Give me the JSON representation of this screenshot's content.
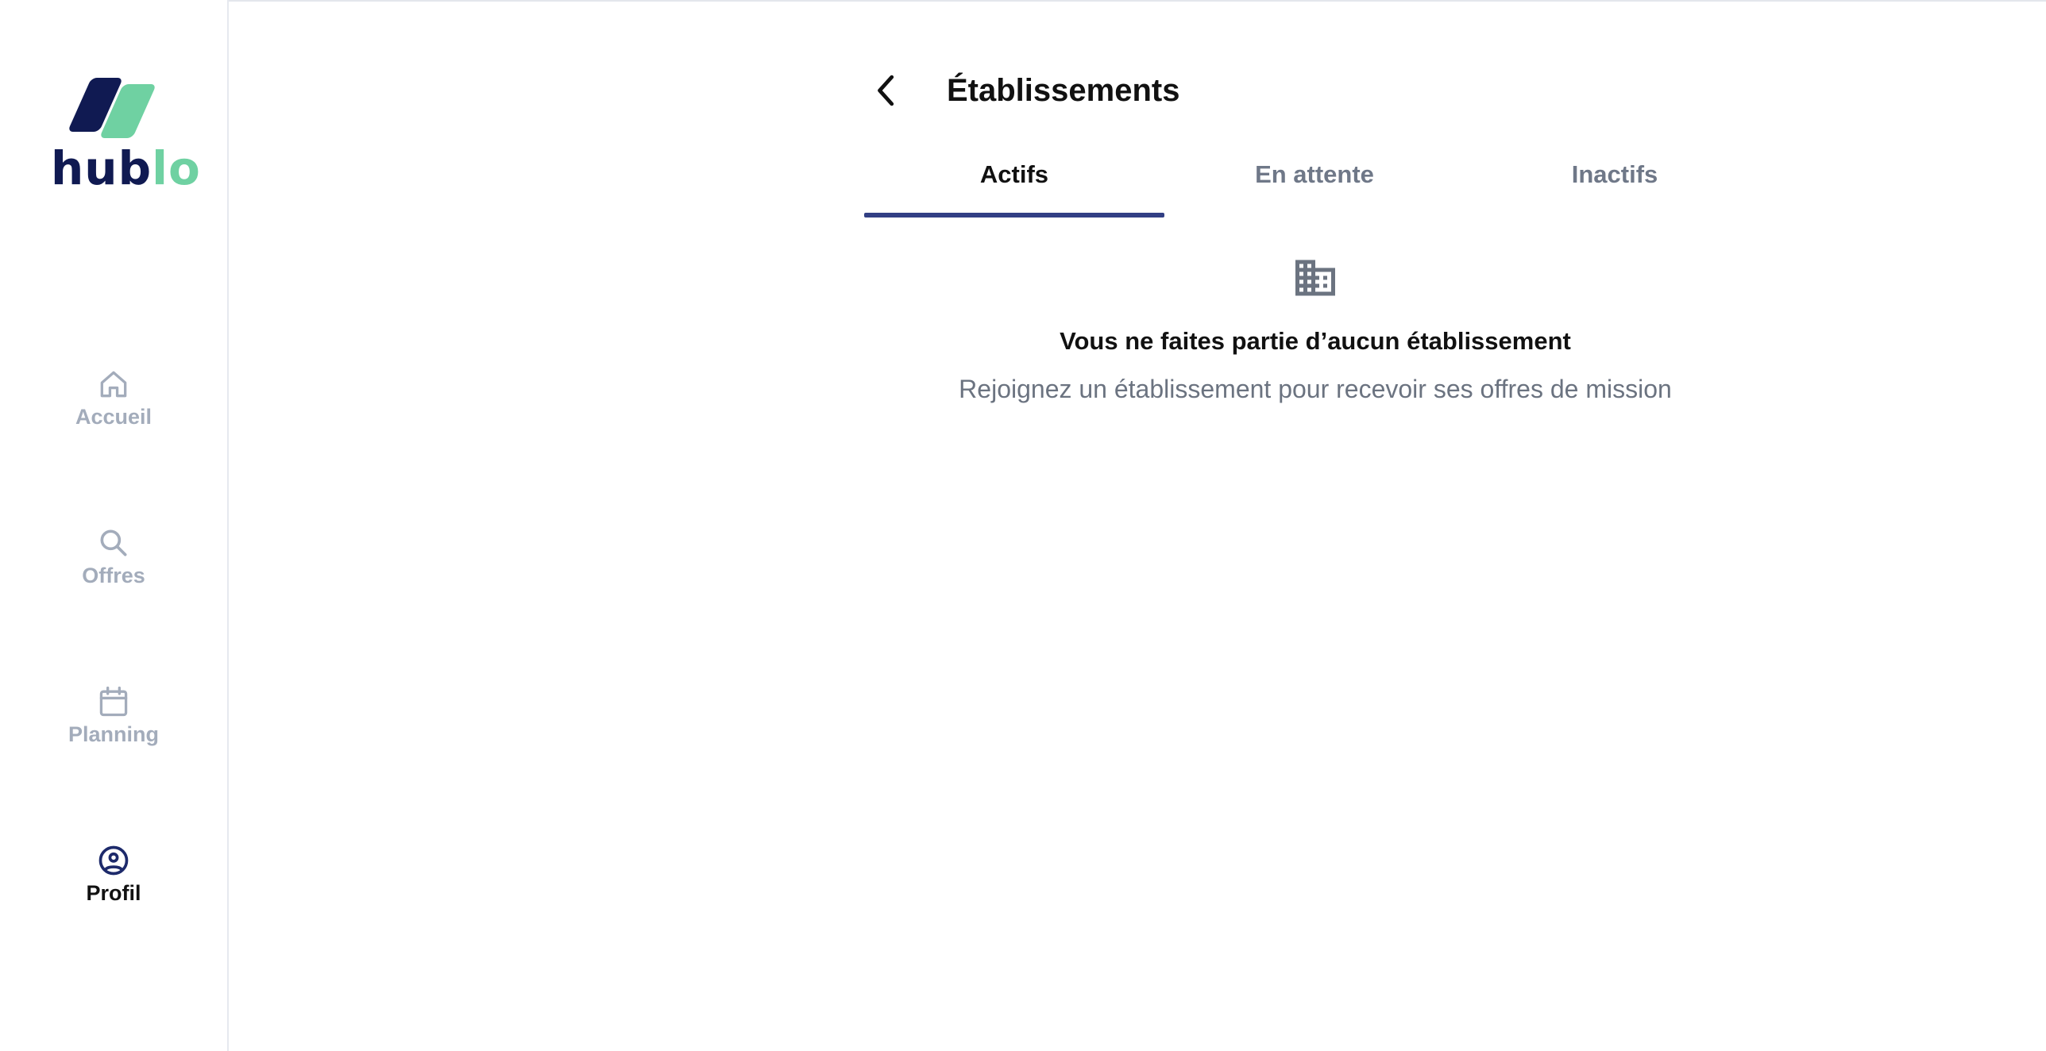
{
  "brand": {
    "name_part1": "hub",
    "name_part2": "lo",
    "primary_color": "#101a52",
    "accent_color": "#6fd1a2"
  },
  "sidebar": {
    "items": [
      {
        "label": "Accueil",
        "icon": "home-icon",
        "active": false
      },
      {
        "label": "Offres",
        "icon": "search-icon",
        "active": false
      },
      {
        "label": "Planning",
        "icon": "calendar-icon",
        "active": false
      },
      {
        "label": "Profil",
        "icon": "user-circle-icon",
        "active": true
      }
    ]
  },
  "header": {
    "title": "Établissements",
    "back_icon": "chevron-left-icon"
  },
  "tabs": [
    {
      "label": "Actifs",
      "active": true
    },
    {
      "label": "En attente",
      "active": false
    },
    {
      "label": "Inactifs",
      "active": false
    }
  ],
  "empty_state": {
    "icon": "building-icon",
    "title": "Vous ne faites partie d’aucun établissement",
    "subtitle": "Rejoignez un établissement pour recevoir ses offres de mission"
  },
  "colors": {
    "tab_indicator": "#323f84",
    "inactive_text": "#a3acbb",
    "muted_text": "#6b7380"
  }
}
